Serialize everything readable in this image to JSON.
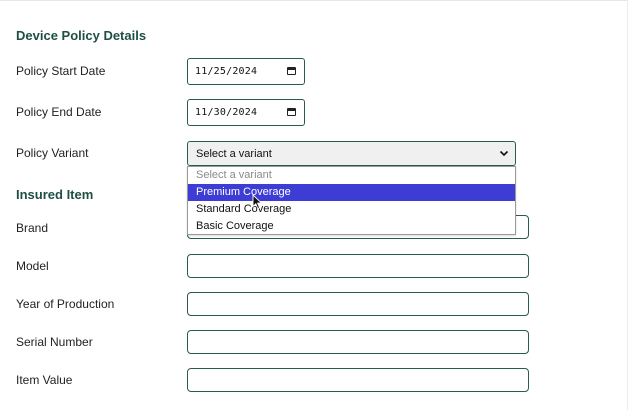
{
  "device_policy": {
    "title": "Device Policy Details",
    "start_date": {
      "label": "Policy Start Date",
      "value": "11/25/2024"
    },
    "end_date": {
      "label": "Policy End Date",
      "value": "11/30/2024"
    },
    "variant": {
      "label": "Policy Variant",
      "selected": "Select a variant",
      "options": [
        "Select a variant",
        "Premium Coverage",
        "Standard Coverage",
        "Basic Coverage"
      ],
      "highlighted_option": "Premium Coverage"
    }
  },
  "insured_item": {
    "title": "Insured Item",
    "fields": [
      {
        "label": "Brand",
        "value": ""
      },
      {
        "label": "Model",
        "value": ""
      },
      {
        "label": "Year of Production",
        "value": ""
      },
      {
        "label": "Serial Number",
        "value": ""
      },
      {
        "label": "Item Value",
        "value": ""
      }
    ]
  },
  "colors": {
    "section_title": "#1f4f43",
    "input_border": "#2b5a4e",
    "highlight": "#3d3dd6"
  },
  "icons": {
    "date_picker": "calendar-icon",
    "select_arrow": "chevron-down-icon",
    "pointer": "mouse-cursor-icon"
  }
}
